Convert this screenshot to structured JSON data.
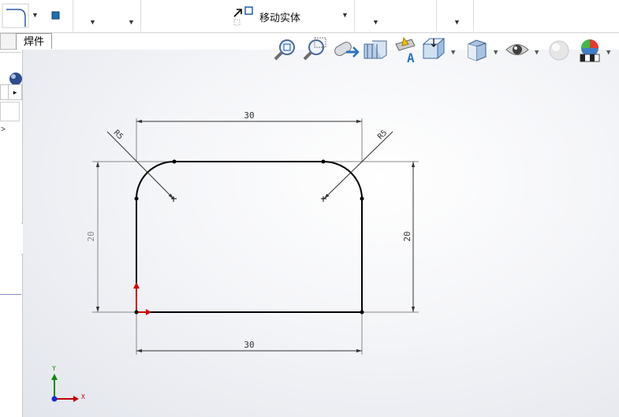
{
  "ribbon": {
    "move_body_label": "移动实体"
  },
  "tabs": {
    "weldment": "焊件"
  },
  "left_panel": {
    "expander": ">",
    "scroll_arrow": "▸"
  },
  "sketch": {
    "dimensions": {
      "top_width": "30",
      "bottom_width": "30",
      "left_height": "20",
      "right_height": "20",
      "left_radius": "R5",
      "right_radius": "R5"
    }
  },
  "triad": {
    "x_label": "X",
    "y_label": "Y"
  },
  "hud_icons": [
    "zoom-to-fit-icon",
    "zoom-to-area-icon",
    "previous-view-icon",
    "section-view-icon",
    "dynamic-annotation-icon",
    "view-orientation-icon",
    "display-style-icon",
    "hide-show-icon",
    "edit-appearance-icon",
    "apply-scene-icon"
  ],
  "colors": {
    "sketch_line": "#000000",
    "dimension_line": "#606060",
    "origin_red": "#d40000",
    "axis_green": "#0a8a0a",
    "axis_blue": "#1a2ad8"
  }
}
